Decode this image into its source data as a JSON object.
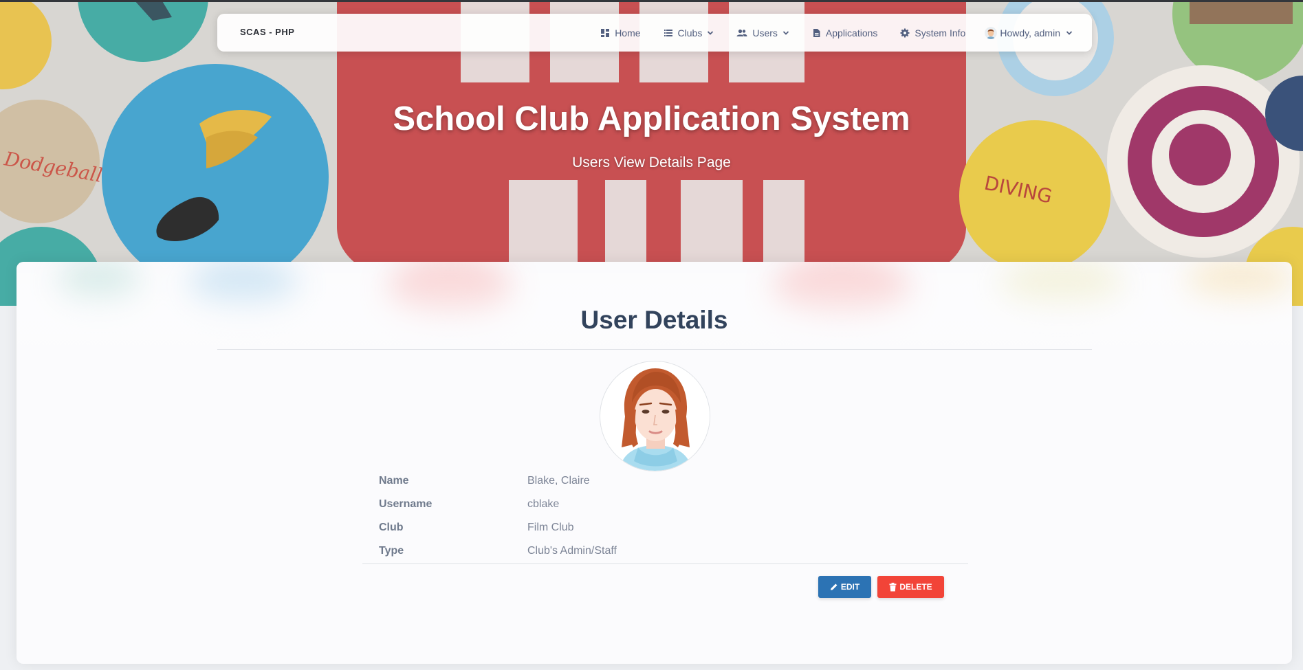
{
  "navbar": {
    "brand": "SCAS - PHP",
    "items": [
      {
        "label": "Home",
        "icon": "dashboard-icon",
        "dropdown": false
      },
      {
        "label": "Clubs",
        "icon": "list-icon",
        "dropdown": true
      },
      {
        "label": "Users",
        "icon": "people-icon",
        "dropdown": true
      },
      {
        "label": "Applications",
        "icon": "document-icon",
        "dropdown": false
      },
      {
        "label": "System Info",
        "icon": "gear-icon",
        "dropdown": false
      }
    ],
    "user_menu": {
      "label": "Howdy, admin",
      "icon": "avatar-icon"
    }
  },
  "hero": {
    "title": "School Club Application System",
    "subtitle": "Users View Details Page",
    "background_art": [
      "Dodgeball",
      "DIVING"
    ]
  },
  "card": {
    "title": "User Details",
    "details": [
      {
        "label": "Name",
        "value": "Blake, Claire"
      },
      {
        "label": "Username",
        "value": "cblake"
      },
      {
        "label": "Club",
        "value": "Film Club"
      },
      {
        "label": "Type",
        "value": "Club's Admin/Staff"
      }
    ],
    "buttons": {
      "edit_label": "EDIT",
      "delete_label": "DELETE"
    }
  },
  "colors": {
    "edit_button": "#2c73b4",
    "delete_button": "#f24438",
    "title_text": "#32435c",
    "hero_red": "#c44345"
  }
}
